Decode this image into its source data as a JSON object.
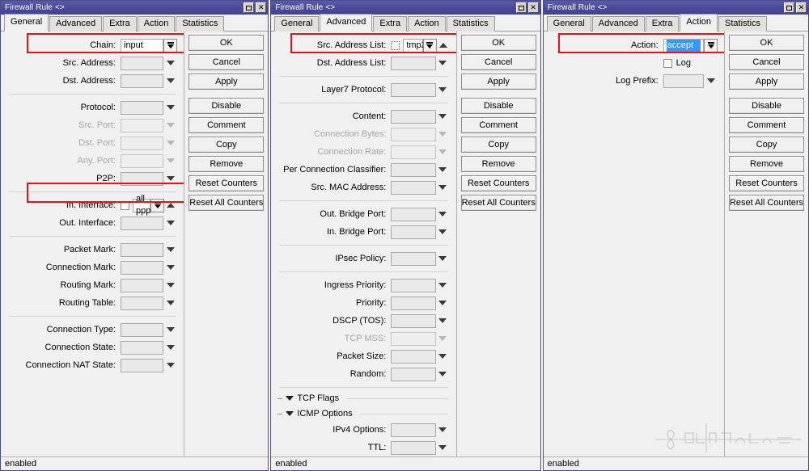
{
  "window_title": "Firewall Rule <>",
  "status_text": "enabled",
  "accent_highlight": "#ee1111",
  "selection_color": "#3399ff",
  "titlebar_color": "#4b4b9c",
  "titlebar": {
    "maximize_icon": "maximize-icon",
    "close_icon": "close-icon",
    "close_label": "✕"
  },
  "tabs": [
    {
      "label": "General"
    },
    {
      "label": "Advanced"
    },
    {
      "label": "Extra"
    },
    {
      "label": "Action"
    },
    {
      "label": "Statistics"
    }
  ],
  "buttons": [
    {
      "label": "OK"
    },
    {
      "label": "Cancel"
    },
    {
      "label": "Apply"
    },
    {
      "label": "Disable"
    },
    {
      "label": "Comment"
    },
    {
      "label": "Copy"
    },
    {
      "label": "Remove"
    },
    {
      "label": "Reset Counters"
    },
    {
      "label": "Reset All Counters"
    }
  ],
  "window1": {
    "active_tab": "General",
    "fields": {
      "chain": {
        "label": "Chain:",
        "value": "input"
      },
      "src_address": {
        "label": "Src. Address:",
        "value": ""
      },
      "dst_address": {
        "label": "Dst. Address:",
        "value": ""
      },
      "protocol": {
        "label": "Protocol:",
        "value": ""
      },
      "src_port": {
        "label": "Src. Port:",
        "value": ""
      },
      "dst_port": {
        "label": "Dst. Port:",
        "value": ""
      },
      "any_port": {
        "label": "Any. Port:",
        "value": ""
      },
      "p2p": {
        "label": "P2P:",
        "value": ""
      },
      "in_interface": {
        "label": "In. Interface:",
        "value": "all ppp"
      },
      "out_interface": {
        "label": "Out. Interface:",
        "value": ""
      },
      "packet_mark": {
        "label": "Packet Mark:",
        "value": ""
      },
      "connection_mark": {
        "label": "Connection Mark:",
        "value": ""
      },
      "routing_mark": {
        "label": "Routing Mark:",
        "value": ""
      },
      "routing_table": {
        "label": "Routing Table:",
        "value": ""
      },
      "connection_type": {
        "label": "Connection Type:",
        "value": ""
      },
      "connection_state": {
        "label": "Connection State:",
        "value": ""
      },
      "connection_nat_state": {
        "label": "Connection NAT State:",
        "value": ""
      }
    }
  },
  "window2": {
    "active_tab": "Advanced",
    "fields": {
      "src_address_list": {
        "label": "Src. Address List:",
        "value": "tmp2"
      },
      "dst_address_list": {
        "label": "Dst. Address List:",
        "value": ""
      },
      "layer7_protocol": {
        "label": "Layer7 Protocol:",
        "value": ""
      },
      "content": {
        "label": "Content:",
        "value": ""
      },
      "connection_bytes": {
        "label": "Connection Bytes:",
        "value": ""
      },
      "connection_rate": {
        "label": "Connection Rate:",
        "value": ""
      },
      "per_connection_classifier": {
        "label": "Per Connection Classifier:",
        "value": ""
      },
      "src_mac_address": {
        "label": "Src. MAC Address:",
        "value": ""
      },
      "out_bridge_port": {
        "label": "Out. Bridge Port:",
        "value": ""
      },
      "in_bridge_port": {
        "label": "In. Bridge Port:",
        "value": ""
      },
      "ipsec_policy": {
        "label": "IPsec Policy:",
        "value": ""
      },
      "ingress_priority": {
        "label": "Ingress Priority:",
        "value": ""
      },
      "priority": {
        "label": "Priority:",
        "value": ""
      },
      "dscp_tos": {
        "label": "DSCP (TOS):",
        "value": ""
      },
      "tcp_mss": {
        "label": "TCP MSS:",
        "value": ""
      },
      "packet_size": {
        "label": "Packet Size:",
        "value": ""
      },
      "random": {
        "label": "Random:",
        "value": ""
      },
      "ipv4_options": {
        "label": "IPv4 Options:",
        "value": ""
      },
      "ttl": {
        "label": "TTL:",
        "value": ""
      }
    },
    "groups": [
      {
        "label": "TCP Flags"
      },
      {
        "label": "ICMP Options"
      }
    ]
  },
  "window3": {
    "active_tab": "Action",
    "fields": {
      "action": {
        "label": "Action:",
        "value": "accept"
      },
      "log": {
        "label": "Log",
        "checked": false
      },
      "log_prefix": {
        "label": "Log Prefix:",
        "value": ""
      }
    }
  },
  "watermark": {
    "text": "سیسکو آموزش آزاد"
  }
}
